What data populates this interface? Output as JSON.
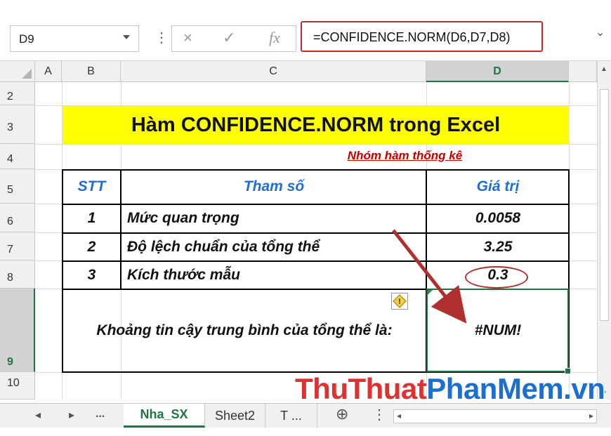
{
  "formula_bar": {
    "name_box": "D9",
    "formula": "=CONFIDENCE.NORM(D6,D7,D8)",
    "cancel_icon": "×",
    "enter_icon": "✓",
    "fx_label": "fx"
  },
  "columns": [
    "A",
    "B",
    "C",
    "D"
  ],
  "rows": [
    "2",
    "3",
    "4",
    "5",
    "6",
    "7",
    "8",
    "9",
    "10"
  ],
  "sheet": {
    "title": "Hàm CONFIDENCE.NORM trong Excel",
    "subtitle": "Nhóm hàm thống kê",
    "headers": {
      "stt": "STT",
      "param": "Tham số",
      "value": "Giá trị"
    },
    "data_rows": [
      {
        "stt": "1",
        "param": "Mức quan trọng",
        "value": "0.0058"
      },
      {
        "stt": "2",
        "param": "Độ lệch chuẩn của tổng thể",
        "value": "3.25"
      },
      {
        "stt": "3",
        "param": "Kích thước mẫu",
        "value": "0.3"
      }
    ],
    "result_label": "Khoảng tin cậy trung bình của tổng thể là:",
    "result_value": "#NUM!"
  },
  "tabs": [
    {
      "label": "Nha_SX",
      "active": true
    },
    {
      "label": "Sheet2",
      "active": false
    },
    {
      "label": "T ...",
      "active": false
    }
  ],
  "tab_nav": {
    "prev": "◂",
    "next": "▸",
    "more": "...",
    "add": "⊕"
  },
  "watermark": {
    "part1": "ThuThuat",
    "part2": "PhanMem.vn"
  },
  "colors": {
    "accent": "#217346",
    "title_bg": "#ffff00",
    "header_text": "#1f6fd0",
    "highlight": "#b03030",
    "subtitle": "#c00000"
  }
}
